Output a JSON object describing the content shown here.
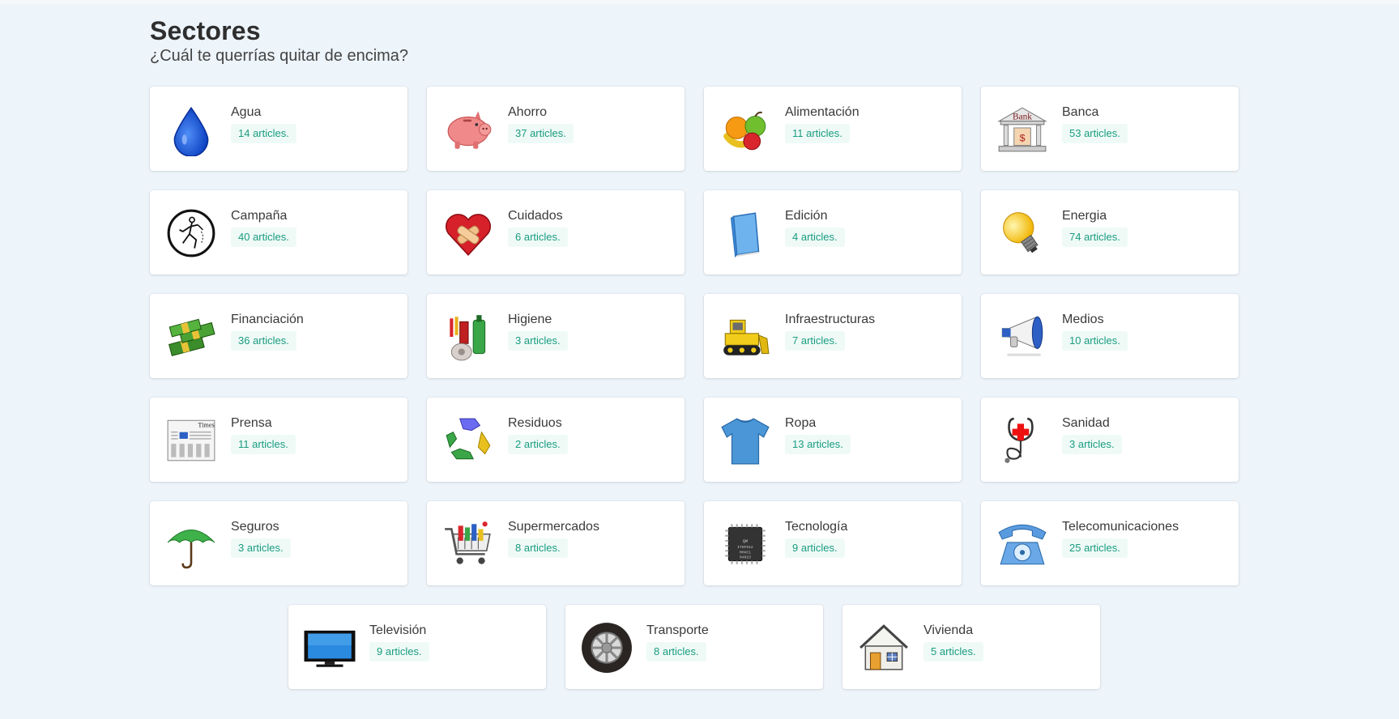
{
  "page": {
    "title": "Sectores",
    "subtitle": "¿Cuál te querrías quitar de encima?"
  },
  "sectors": [
    {
      "name": "Agua",
      "count": "14 articles.",
      "icon": "water-drop-icon"
    },
    {
      "name": "Ahorro",
      "count": "37 articles.",
      "icon": "piggy-bank-icon"
    },
    {
      "name": "Alimentación",
      "count": "11 articles.",
      "icon": "fruit-icon"
    },
    {
      "name": "Banca",
      "count": "53 articles.",
      "icon": "bank-icon",
      "icon_text": "Bank"
    },
    {
      "name": "Campaña",
      "count": "40 articles.",
      "icon": "campaign-icon"
    },
    {
      "name": "Cuidados",
      "count": "6 articles.",
      "icon": "bandaged-heart-icon"
    },
    {
      "name": "Edición",
      "count": "4 articles.",
      "icon": "book-icon"
    },
    {
      "name": "Energia",
      "count": "74 articles.",
      "icon": "light-bulb-icon"
    },
    {
      "name": "Financiación",
      "count": "36 articles.",
      "icon": "money-stacks-icon"
    },
    {
      "name": "Higiene",
      "count": "3 articles.",
      "icon": "hygiene-products-icon"
    },
    {
      "name": "Infraestructuras",
      "count": "7 articles.",
      "icon": "bulldozer-icon"
    },
    {
      "name": "Medios",
      "count": "10 articles.",
      "icon": "megaphone-icon"
    },
    {
      "name": "Prensa",
      "count": "11 articles.",
      "icon": "newspaper-icon",
      "icon_text": "Times"
    },
    {
      "name": "Residuos",
      "count": "2 articles.",
      "icon": "recycle-icon"
    },
    {
      "name": "Ropa",
      "count": "13 articles.",
      "icon": "tshirt-icon"
    },
    {
      "name": "Sanidad",
      "count": "3 articles.",
      "icon": "stethoscope-icon"
    },
    {
      "name": "Seguros",
      "count": "3 articles.",
      "icon": "umbrella-icon"
    },
    {
      "name": "Supermercados",
      "count": "8 articles.",
      "icon": "shopping-cart-icon"
    },
    {
      "name": "Tecnología",
      "count": "9 articles.",
      "icon": "microchip-icon",
      "icon_text": "QM IT8F512 MHVC1 04023"
    },
    {
      "name": "Telecomunicaciones",
      "count": "25 articles.",
      "icon": "telephone-icon"
    },
    {
      "name": "Televisión",
      "count": "9 articles.",
      "icon": "television-icon"
    },
    {
      "name": "Transporte",
      "count": "8 articles.",
      "icon": "wheel-icon"
    },
    {
      "name": "Vivienda",
      "count": "5 articles.",
      "icon": "house-icon"
    }
  ],
  "colors": {
    "background": "#edf4fa",
    "badge_bg": "#effaf7",
    "badge_text": "#1a9c7f"
  }
}
